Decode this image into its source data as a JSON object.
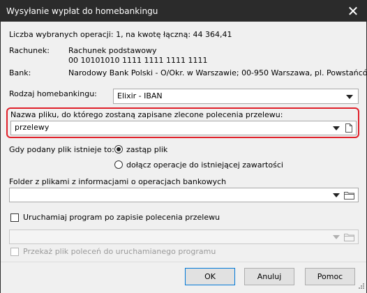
{
  "window": {
    "title": "Wysyłanie wypłat do homebankingu"
  },
  "summary": "Liczba wybranych operacji: 1, na kwotę łączną: 44 364,41",
  "account": {
    "label": "Rachunek:",
    "name": "Rachunek podstawowy",
    "number": "00 10101010 1111 1111 1111 1111"
  },
  "bank": {
    "label": "Bank:",
    "value": "Narodowy Bank Polski  - O/Okr. w Warszawie; 00-950 Warszawa, pl. Powstańców"
  },
  "homebanking": {
    "label": "Rodzaj homebankingu:",
    "selected": "Elixir - IBAN"
  },
  "filename": {
    "label": "Nazwa pliku, do którego zostaną zapisane zlecone polecenia przelewu:",
    "value": "przelewy"
  },
  "file_exists": {
    "label": "Gdy podany plik istnieje to:",
    "options": [
      {
        "label": "zastąp plik",
        "selected": true
      },
      {
        "label": "dołącz operacje do istniejącej zawartości",
        "selected": false
      }
    ]
  },
  "folder": {
    "label": "Folder z plikami z informacjami o operacjach bankowych",
    "value": ""
  },
  "run_program": {
    "label": "Uruchamiaj program po zapisie polecenia przelewu",
    "checked": false,
    "path": ""
  },
  "pass_file": {
    "label": "Przekaż plik poleceń do uruchamianego programu",
    "checked": false,
    "enabled": false
  },
  "buttons": {
    "ok": "OK",
    "cancel": "Anuluj",
    "help": "Pomoc"
  },
  "colors": {
    "titlebar": "#2b2b2b",
    "highlight": "#e0202a",
    "dialog_bg": "#f0f0f0"
  }
}
